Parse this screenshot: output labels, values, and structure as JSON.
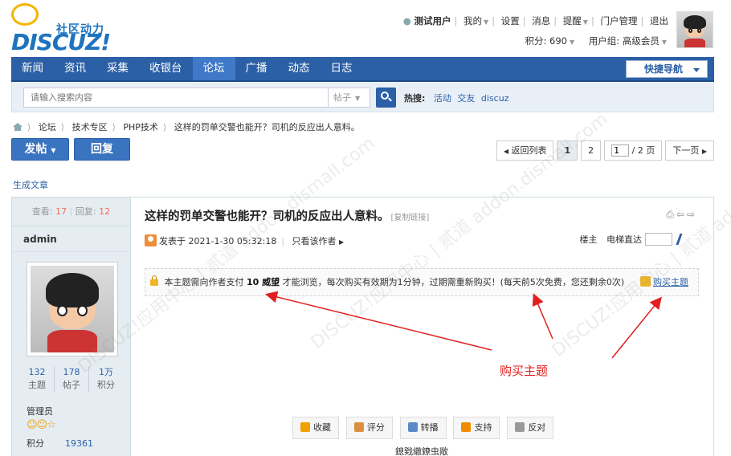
{
  "logo": {
    "cn": "社区动力",
    "en": "DISCUZ!"
  },
  "user": {
    "name": "测试用户",
    "links": [
      "我的",
      "设置",
      "消息",
      "提醒",
      "门户管理",
      "退出"
    ],
    "points_label": "积分: 690",
    "group_label": "用户组: 高级会员"
  },
  "nav": {
    "items": [
      "新闻",
      "资讯",
      "采集",
      "收银台",
      "论坛",
      "广播",
      "动态",
      "日志"
    ],
    "active": "论坛",
    "quick_nav": "快捷导航"
  },
  "search": {
    "placeholder": "请输入搜索内容",
    "type": "帖子",
    "hot_label": "热搜:",
    "hot_terms": [
      "活动",
      "交友",
      "discuz"
    ]
  },
  "breadcrumb": [
    "论坛",
    "技术专区",
    "PHP技术",
    "这样的罚单交警也能开？司机的反应出人意料。"
  ],
  "actions": {
    "post": "发帖",
    "reply": "回复"
  },
  "pager": {
    "back": "返回列表",
    "pages": [
      "1",
      "2"
    ],
    "current": "1",
    "input_value": "1",
    "total": "/ 2 页",
    "next": "下一页"
  },
  "generate_article": "生成文章",
  "thread": {
    "views_label": "查看:",
    "views": "17",
    "replies_label": "回复:",
    "replies": "12",
    "author": "admin",
    "title": "这样的罚单交警也能开？司机的反应出人意料。",
    "copy_link": "[复制链接]",
    "posted_label": "发表于 2021-1-30 05:32:18",
    "author_only": "只看该作者",
    "floor_label": "楼主",
    "jump_label": "电梯直达"
  },
  "author_stats": [
    {
      "value": "132",
      "label": "主题"
    },
    {
      "value": "178",
      "label": "帖子"
    },
    {
      "value": "1万",
      "label": "积分"
    }
  ],
  "author_role": "管理员",
  "author_points_label": "积分",
  "author_points": "19361",
  "lock": {
    "prefix": "本主题需向作者支付",
    "amount": "10 威望",
    "suffix": "才能浏览，每次购买有效期为1分钟，过期需重新购买！(每天前5次免费，您还剩余0次)",
    "buy": "购买主题"
  },
  "annotation": "购买主题",
  "post_buttons": [
    {
      "label": "收藏",
      "icon": "star-icon",
      "color": "#f0a000"
    },
    {
      "label": "评分",
      "icon": "thumb-icon",
      "color": "#d99040"
    },
    {
      "label": "转播",
      "icon": "share-icon",
      "color": "#5a8ac6"
    },
    {
      "label": "支持",
      "icon": "up-arrow-icon",
      "color": "#f08c00"
    },
    {
      "label": "反对",
      "icon": "down-arrow-icon",
      "color": "#999999"
    }
  ],
  "garbled_text": "鎴戣繖鐐虫敞",
  "watermark": "DISCUZ!应用中心 | 贰道 addon.dismall.com"
}
